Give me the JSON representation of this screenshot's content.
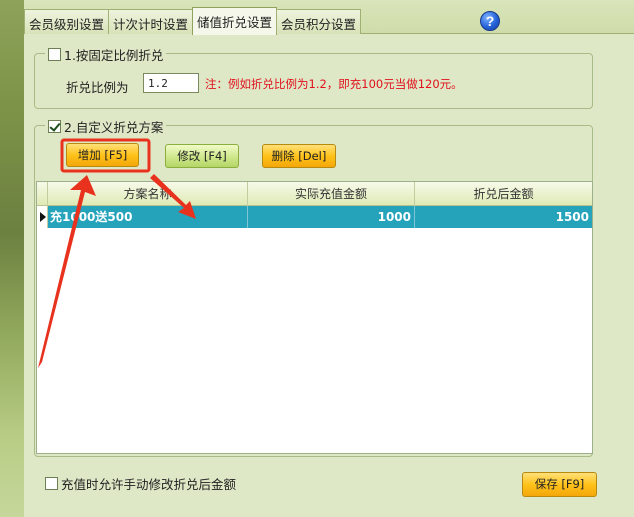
{
  "tabs": [
    {
      "label": "会员级别设置"
    },
    {
      "label": "计次计时设置"
    },
    {
      "label": "储值折兑设置"
    },
    {
      "label": "会员积分设置"
    }
  ],
  "help": {
    "glyph": "?"
  },
  "fixed_ratio": {
    "title": "1.按固定比例折兑",
    "checked": false,
    "ratio_label": "折兑比例为",
    "ratio_value": "1.2",
    "note": "注：例如折兑比例为1.2，即充100元当做120元。"
  },
  "custom": {
    "title": "2.自定义折兑方案",
    "checked": true,
    "add_label": "增加 [F5]",
    "edit_label": "修改 [F4]",
    "delete_label": "删除 [Del]"
  },
  "grid": {
    "columns": [
      "方案名称",
      "实际充值金额",
      "折兑后金额"
    ],
    "rows": [
      {
        "name": "充1000送500",
        "actual": "1000",
        "after": "1500"
      }
    ]
  },
  "footer": {
    "allow_manual_label": "充值时允许手动修改折兑后金额",
    "allow_manual_checked": false,
    "save_label": "保存 [F9]"
  },
  "colors": {
    "selected_row": "#25a3bb",
    "note_text": "#e0101e",
    "annotation_red": "#e8321e"
  }
}
